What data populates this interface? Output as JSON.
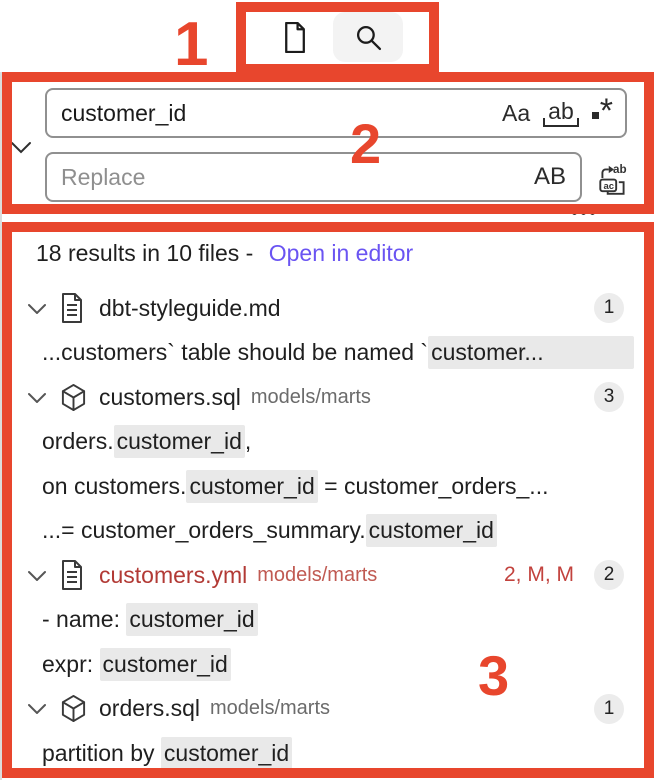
{
  "colors": {
    "annotation_red": "#e8462d",
    "link_purple": "#6a54f2",
    "error_red": "#b23a35",
    "match_highlight": "#e9e9e9",
    "badge_bg": "#ececec",
    "active_tab_bg": "#f3f3f3"
  },
  "annotations": {
    "labels": [
      "1",
      "2",
      "3"
    ]
  },
  "toolbar": {
    "tabs": [
      {
        "icon": "new-file-icon",
        "active": false
      },
      {
        "icon": "search-icon",
        "active": true
      }
    ]
  },
  "search": {
    "query": "customer_id",
    "replace_placeholder": "Replace",
    "match_case_label": "Aa",
    "whole_word_label": "ab",
    "regex_label": "*",
    "preserve_case_label": "AB",
    "toggle_replace_icon": "chevron-down-icon",
    "replace_all_icon": "replace-all-icon",
    "more_icon": "ellipsis-icon"
  },
  "results": {
    "summary_prefix": "18 results in 10 files -",
    "open_in_editor_label": "Open in editor",
    "files": [
      {
        "name": "dbt-styleguide.md",
        "path": "",
        "badge": "1",
        "icon": "document-icon",
        "matches": [
          {
            "pre": "...customers` table should be named `",
            "match": "customer...",
            "post": ""
          }
        ]
      },
      {
        "name": "customers.sql",
        "path": "models/marts",
        "badge": "3",
        "icon": "cube-icon",
        "matches": [
          {
            "pre": "orders.",
            "match": "customer_id",
            "post": ","
          },
          {
            "pre": "on customers.",
            "match": "customer_id",
            "post": " = customer_orders_..."
          },
          {
            "pre": "...= customer_orders_summary.",
            "match": "customer_id",
            "post": ""
          }
        ]
      },
      {
        "name": "customers.yml",
        "path": "models/marts",
        "badge": "2",
        "icon": "document-icon",
        "status": "2, M, M",
        "matches": [
          {
            "pre": "- name: ",
            "match": "customer_id",
            "post": ""
          },
          {
            "pre": "expr: ",
            "match": "customer_id",
            "post": ""
          }
        ]
      },
      {
        "name": "orders.sql",
        "path": "models/marts",
        "badge": "1",
        "icon": "cube-icon",
        "matches": [
          {
            "pre": "partition by ",
            "match": "customer_id",
            "post": ""
          }
        ]
      }
    ]
  }
}
